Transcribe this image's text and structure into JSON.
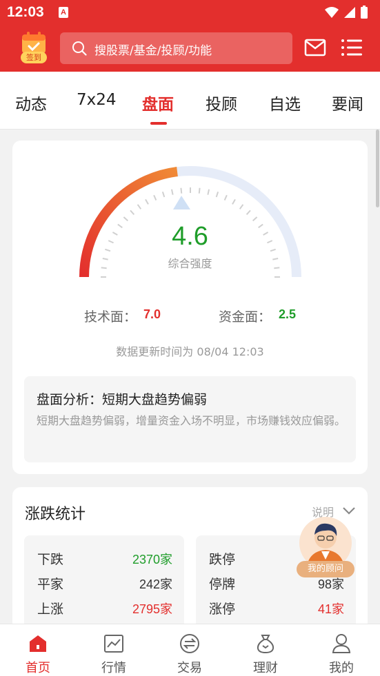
{
  "status_bar": {
    "time": "12:03",
    "app_badge": "A"
  },
  "header": {
    "signin_label": "签到",
    "search_placeholder": "搜股票/基金/投顾/功能"
  },
  "tabs": [
    {
      "label": "动态",
      "active": false
    },
    {
      "label": "7x24",
      "active": false
    },
    {
      "label": "盘面",
      "active": true
    },
    {
      "label": "投顾",
      "active": false
    },
    {
      "label": "自选",
      "active": false
    },
    {
      "label": "要闻",
      "active": false
    }
  ],
  "sentiment": {
    "score": "4.6",
    "score_label": "综合强度",
    "technical_label": "技术面：",
    "technical_value": "7.0",
    "capital_label": "资金面：",
    "capital_value": "2.5",
    "updated": "数据更新时间为 08/04 12:03",
    "analysis_title": "盘面分析：短期大盘趋势偏弱",
    "analysis_body": "短期大盘趋势偏弱，增量资金入场不明显，市场赚钱效应偏弱。"
  },
  "stats": {
    "title": "涨跌统计",
    "note": "说明",
    "left": [
      {
        "label": "下跌",
        "value": "2370",
        "unit": "家"
      },
      {
        "label": "平家",
        "value": "242",
        "unit": "家"
      },
      {
        "label": "上涨",
        "value": "2795",
        "unit": "家"
      }
    ],
    "right": [
      {
        "label": "跌停",
        "value": "",
        "unit": ""
      },
      {
        "label": "停牌",
        "value": "98",
        "unit": "家"
      },
      {
        "label": "涨停",
        "value": "41",
        "unit": "家"
      }
    ]
  },
  "advisor_label": "我的顾问",
  "bottom_nav": [
    {
      "label": "首页",
      "active": true
    },
    {
      "label": "行情",
      "active": false
    },
    {
      "label": "交易",
      "active": false
    },
    {
      "label": "理财",
      "active": false
    },
    {
      "label": "我的",
      "active": false
    }
  ],
  "colors": {
    "brand_red": "#e32f2d",
    "up_red": "#e32f2d",
    "down_green": "#1f9d2a",
    "gauge_track": "#e6ecf8"
  }
}
